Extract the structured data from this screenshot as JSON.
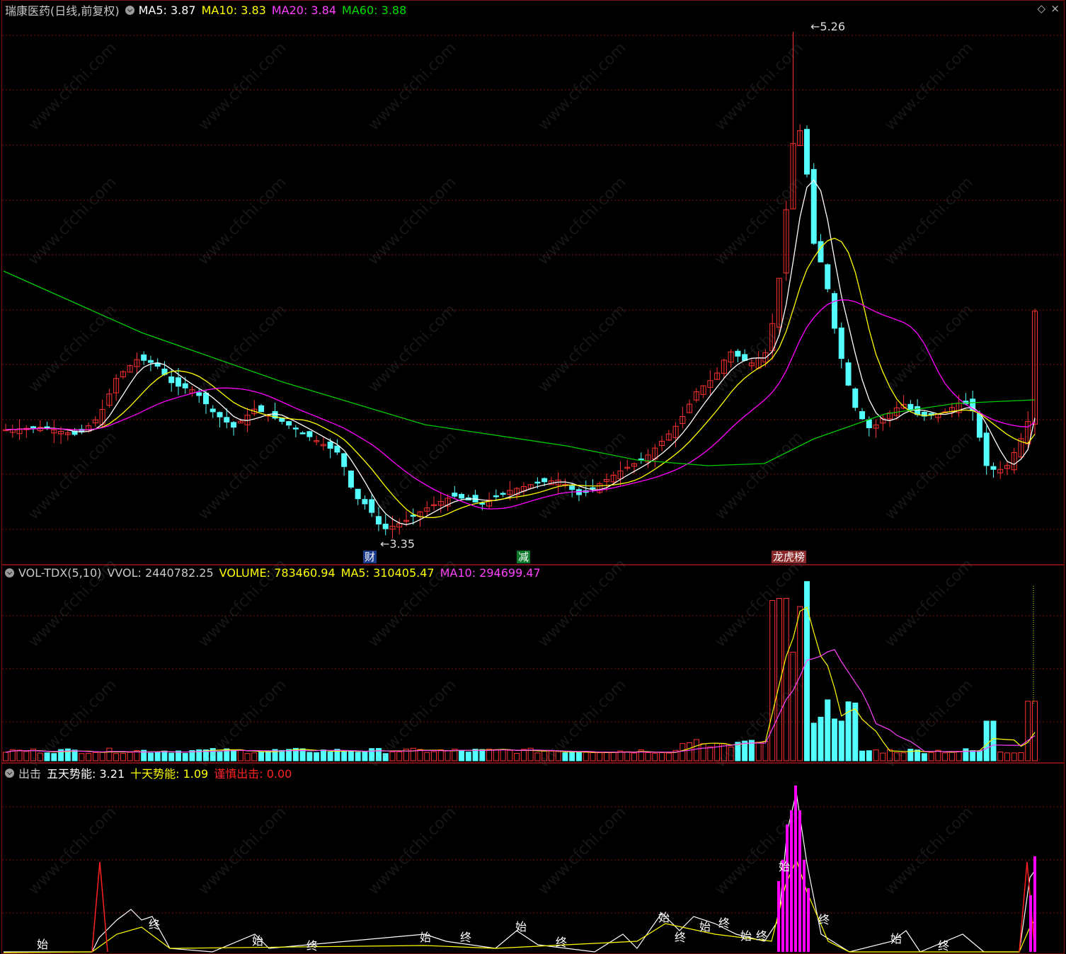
{
  "main": {
    "title": "瑞康医药(日线,前复权)",
    "ma5": "MA5: 3.87",
    "ma10": "MA10: 3.83",
    "ma20": "MA20: 3.84",
    "ma60": "MA60: 3.88",
    "high_label": "5.26",
    "low_label": "3.35",
    "events": [
      "财",
      "减",
      "龙虎榜"
    ]
  },
  "volume": {
    "name": "VOL-TDX(5,10)",
    "vvol": "VVOL: 2440782.25",
    "volume": "VOLUME: 783460.94",
    "ma5": "MA5: 310405.47",
    "ma10": "MA10: 294699.47"
  },
  "indicator": {
    "name": "出击",
    "five_day": "五天势能: 3.21",
    "ten_day": "十天势能: 1.09",
    "caution": "谨慎出击: 0.00",
    "marks": [
      "始",
      "终",
      "始",
      "终",
      "始",
      "终",
      "始",
      "终",
      "始",
      "终",
      "始",
      "终",
      "始",
      "终",
      "始",
      "终"
    ]
  },
  "watermark": "www.cfchi.com",
  "colors": {
    "ma5": "#ffffff",
    "ma10": "#ffff00",
    "ma20": "#ff00ff",
    "ma60": "#00cc00",
    "up": "#ff3030",
    "down": "#54ffff",
    "grid": "#7a1010"
  },
  "chart_data": {
    "type": "candlestick",
    "y_range": [
      3.3,
      5.3
    ],
    "max": 5.26,
    "min": 3.35,
    "days": 150
  }
}
